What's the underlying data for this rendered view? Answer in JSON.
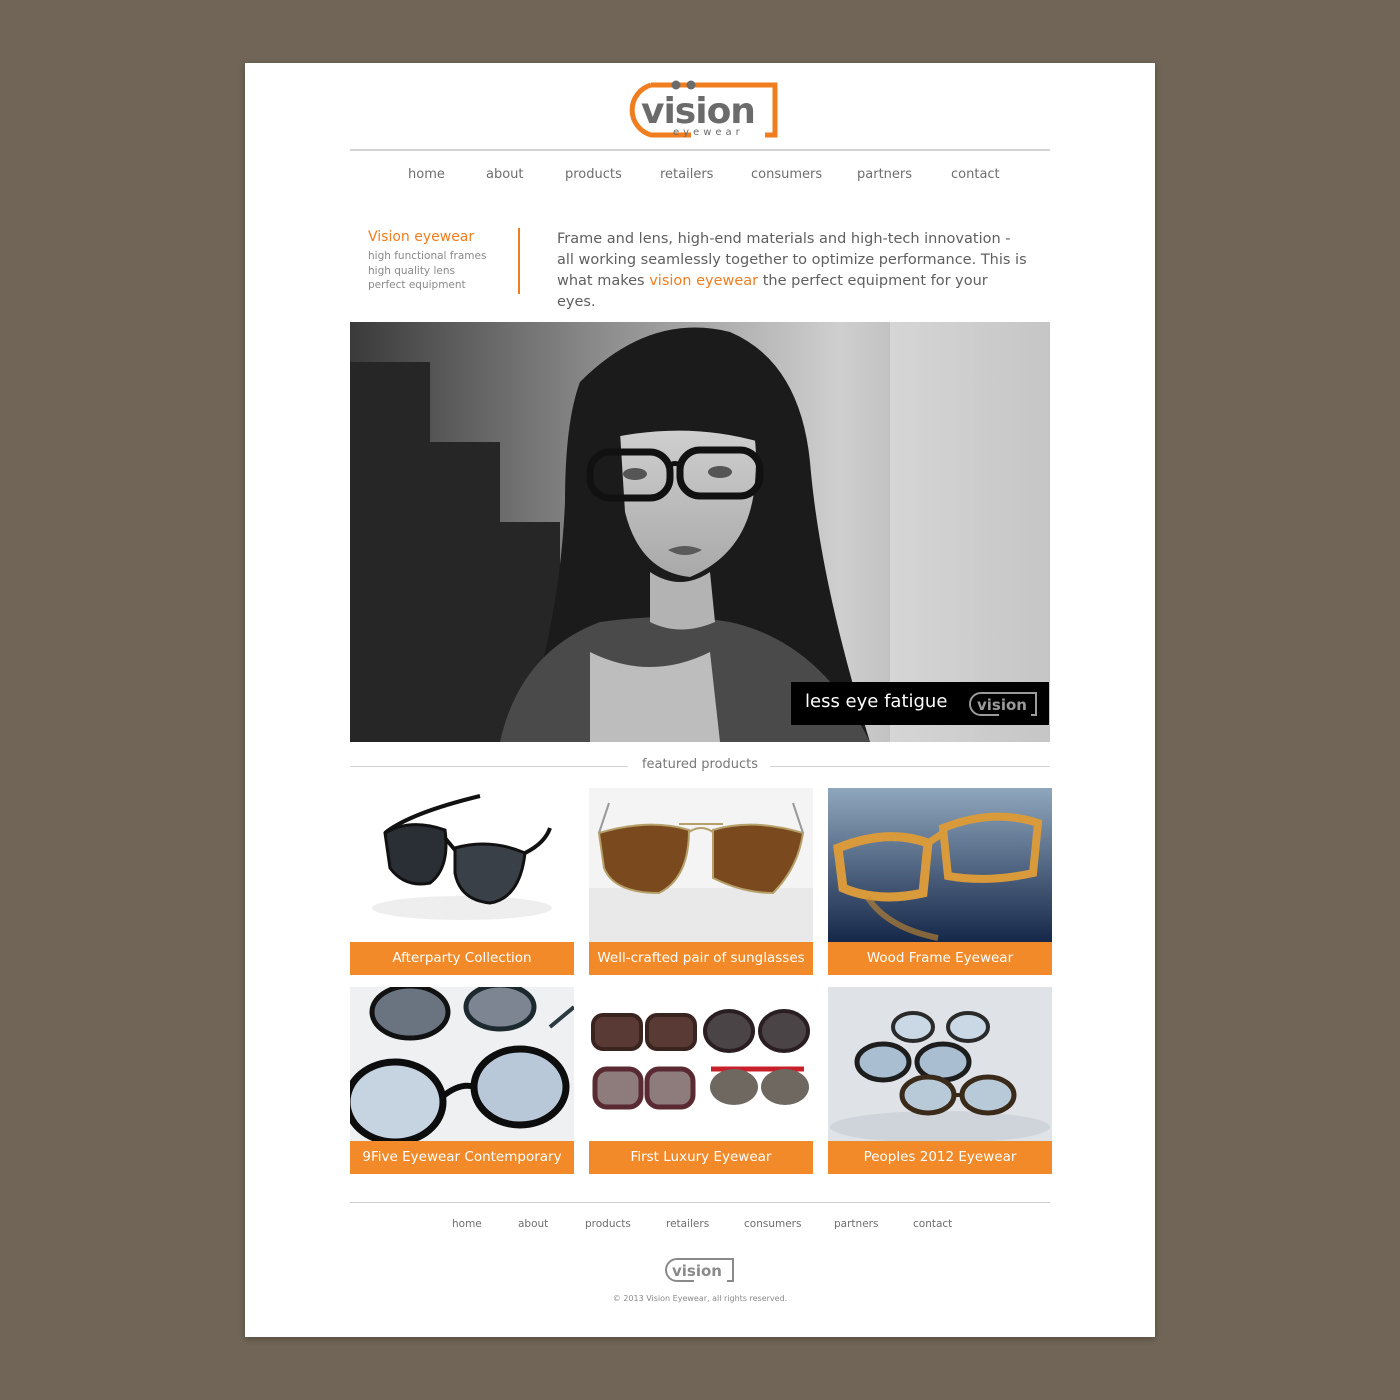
{
  "brand": {
    "name": "vision",
    "tagline": "eyewear",
    "accent_color": "#f07d1e",
    "logo_gray": "#6b6b6b"
  },
  "nav": {
    "items": [
      "home",
      "about",
      "products",
      "retailers",
      "consumers",
      "partners",
      "contact"
    ]
  },
  "intro": {
    "title": "Vision eyewear",
    "lines": [
      "high functional frames",
      "high quality lens",
      "perfect equipment"
    ],
    "text_before": "Frame and lens, high-end materials and high-tech innovation - all working seamlessly together to optimize performance. This is what makes ",
    "text_highlight": "vision eyewear",
    "text_after": " the perfect equipment for your eyes."
  },
  "hero": {
    "caption": "less eye fatigue"
  },
  "featured": {
    "heading": "featured products",
    "products": [
      {
        "name": "Afterparty Collection",
        "icon": "sport-sunglasses-image"
      },
      {
        "name": "Well-crafted pair of sunglasses",
        "icon": "aviator-sunglasses-image"
      },
      {
        "name": "Wood Frame Eyewear",
        "icon": "wood-frame-glasses-image"
      },
      {
        "name": "9Five Eyewear Contemporary",
        "icon": "contemporary-sunglasses-image"
      },
      {
        "name": "First Luxury Eyewear",
        "icon": "luxury-sunglasses-image"
      },
      {
        "name": "Peoples 2012 Eyewear",
        "icon": "peoples-eyewear-image"
      }
    ]
  },
  "footer": {
    "nav": [
      "home",
      "about",
      "products",
      "retailers",
      "consumers",
      "partners",
      "contact"
    ],
    "copyright": "© 2013 Vision Eyewear, all rights reserved."
  }
}
